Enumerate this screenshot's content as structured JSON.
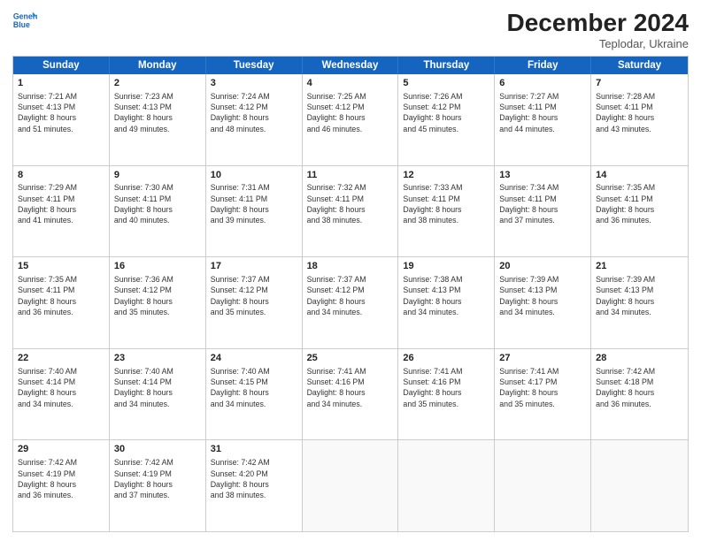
{
  "logo": {
    "line1": "General",
    "line2": "Blue"
  },
  "title": "December 2024",
  "subtitle": "Teplodar, Ukraine",
  "days": [
    "Sunday",
    "Monday",
    "Tuesday",
    "Wednesday",
    "Thursday",
    "Friday",
    "Saturday"
  ],
  "weeks": [
    [
      {
        "day": 1,
        "text": "Sunrise: 7:21 AM\nSunset: 4:13 PM\nDaylight: 8 hours\nand 51 minutes."
      },
      {
        "day": 2,
        "text": "Sunrise: 7:23 AM\nSunset: 4:13 PM\nDaylight: 8 hours\nand 49 minutes."
      },
      {
        "day": 3,
        "text": "Sunrise: 7:24 AM\nSunset: 4:12 PM\nDaylight: 8 hours\nand 48 minutes."
      },
      {
        "day": 4,
        "text": "Sunrise: 7:25 AM\nSunset: 4:12 PM\nDaylight: 8 hours\nand 46 minutes."
      },
      {
        "day": 5,
        "text": "Sunrise: 7:26 AM\nSunset: 4:12 PM\nDaylight: 8 hours\nand 45 minutes."
      },
      {
        "day": 6,
        "text": "Sunrise: 7:27 AM\nSunset: 4:11 PM\nDaylight: 8 hours\nand 44 minutes."
      },
      {
        "day": 7,
        "text": "Sunrise: 7:28 AM\nSunset: 4:11 PM\nDaylight: 8 hours\nand 43 minutes."
      }
    ],
    [
      {
        "day": 8,
        "text": "Sunrise: 7:29 AM\nSunset: 4:11 PM\nDaylight: 8 hours\nand 41 minutes."
      },
      {
        "day": 9,
        "text": "Sunrise: 7:30 AM\nSunset: 4:11 PM\nDaylight: 8 hours\nand 40 minutes."
      },
      {
        "day": 10,
        "text": "Sunrise: 7:31 AM\nSunset: 4:11 PM\nDaylight: 8 hours\nand 39 minutes."
      },
      {
        "day": 11,
        "text": "Sunrise: 7:32 AM\nSunset: 4:11 PM\nDaylight: 8 hours\nand 38 minutes."
      },
      {
        "day": 12,
        "text": "Sunrise: 7:33 AM\nSunset: 4:11 PM\nDaylight: 8 hours\nand 38 minutes."
      },
      {
        "day": 13,
        "text": "Sunrise: 7:34 AM\nSunset: 4:11 PM\nDaylight: 8 hours\nand 37 minutes."
      },
      {
        "day": 14,
        "text": "Sunrise: 7:35 AM\nSunset: 4:11 PM\nDaylight: 8 hours\nand 36 minutes."
      }
    ],
    [
      {
        "day": 15,
        "text": "Sunrise: 7:35 AM\nSunset: 4:11 PM\nDaylight: 8 hours\nand 36 minutes."
      },
      {
        "day": 16,
        "text": "Sunrise: 7:36 AM\nSunset: 4:12 PM\nDaylight: 8 hours\nand 35 minutes."
      },
      {
        "day": 17,
        "text": "Sunrise: 7:37 AM\nSunset: 4:12 PM\nDaylight: 8 hours\nand 35 minutes."
      },
      {
        "day": 18,
        "text": "Sunrise: 7:37 AM\nSunset: 4:12 PM\nDaylight: 8 hours\nand 34 minutes."
      },
      {
        "day": 19,
        "text": "Sunrise: 7:38 AM\nSunset: 4:13 PM\nDaylight: 8 hours\nand 34 minutes."
      },
      {
        "day": 20,
        "text": "Sunrise: 7:39 AM\nSunset: 4:13 PM\nDaylight: 8 hours\nand 34 minutes."
      },
      {
        "day": 21,
        "text": "Sunrise: 7:39 AM\nSunset: 4:13 PM\nDaylight: 8 hours\nand 34 minutes."
      }
    ],
    [
      {
        "day": 22,
        "text": "Sunrise: 7:40 AM\nSunset: 4:14 PM\nDaylight: 8 hours\nand 34 minutes."
      },
      {
        "day": 23,
        "text": "Sunrise: 7:40 AM\nSunset: 4:14 PM\nDaylight: 8 hours\nand 34 minutes."
      },
      {
        "day": 24,
        "text": "Sunrise: 7:40 AM\nSunset: 4:15 PM\nDaylight: 8 hours\nand 34 minutes."
      },
      {
        "day": 25,
        "text": "Sunrise: 7:41 AM\nSunset: 4:16 PM\nDaylight: 8 hours\nand 34 minutes."
      },
      {
        "day": 26,
        "text": "Sunrise: 7:41 AM\nSunset: 4:16 PM\nDaylight: 8 hours\nand 35 minutes."
      },
      {
        "day": 27,
        "text": "Sunrise: 7:41 AM\nSunset: 4:17 PM\nDaylight: 8 hours\nand 35 minutes."
      },
      {
        "day": 28,
        "text": "Sunrise: 7:42 AM\nSunset: 4:18 PM\nDaylight: 8 hours\nand 36 minutes."
      }
    ],
    [
      {
        "day": 29,
        "text": "Sunrise: 7:42 AM\nSunset: 4:19 PM\nDaylight: 8 hours\nand 36 minutes."
      },
      {
        "day": 30,
        "text": "Sunrise: 7:42 AM\nSunset: 4:19 PM\nDaylight: 8 hours\nand 37 minutes."
      },
      {
        "day": 31,
        "text": "Sunrise: 7:42 AM\nSunset: 4:20 PM\nDaylight: 8 hours\nand 38 minutes."
      },
      null,
      null,
      null,
      null
    ]
  ]
}
